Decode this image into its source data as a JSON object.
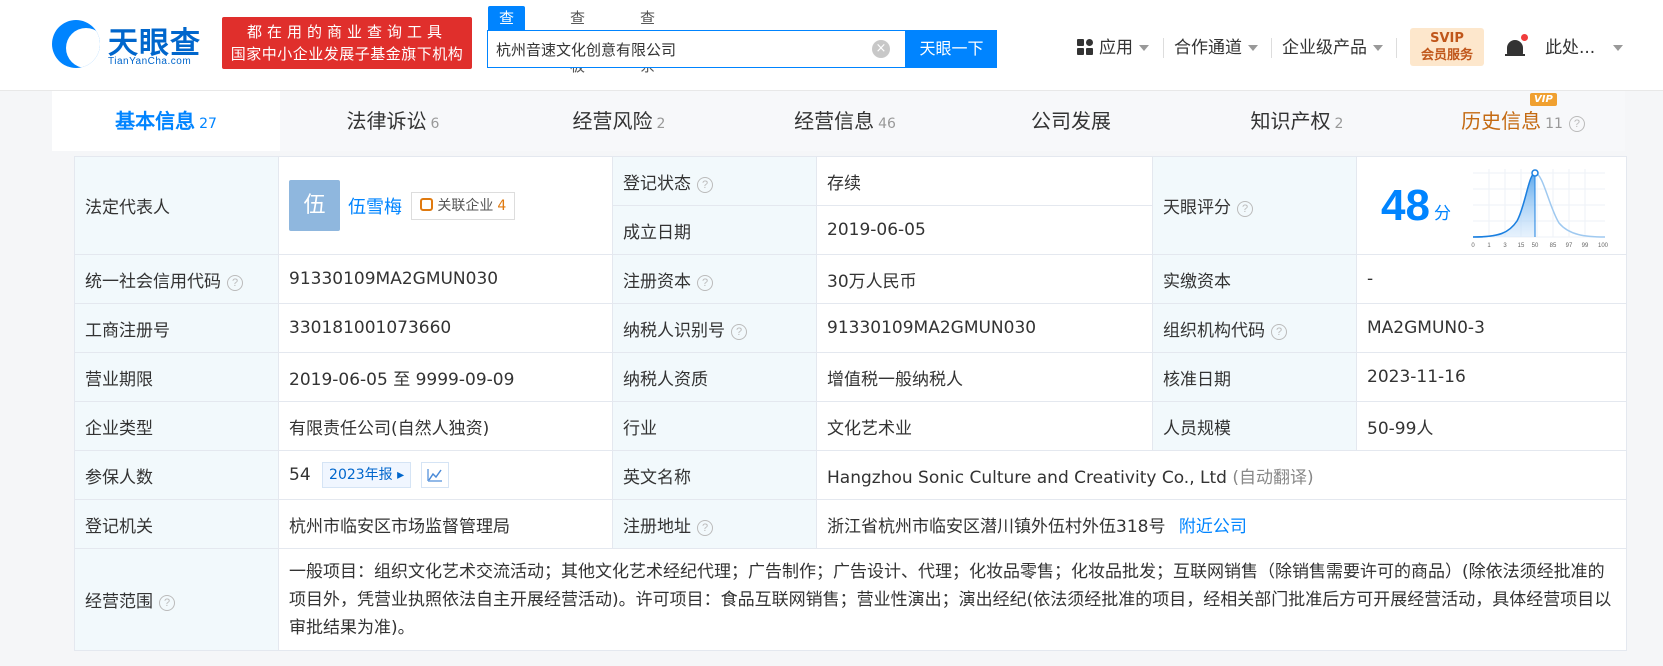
{
  "header": {
    "logo_name": "天眼查",
    "logo_domain": "TianYanCha.com",
    "slogan_line1": "都在用的商业查询工具",
    "slogan_line2": "国家中小企业发展子基金旗下机构",
    "search_tabs": [
      "查公司",
      "查老板",
      "查关系"
    ],
    "search_value": "杭州音速文化创意有限公司",
    "search_button": "天眼一下",
    "nav": {
      "apps": "应用",
      "partners": "合作通道",
      "enterprise": "企业级产品",
      "svip_line1": "SVIP",
      "svip_line2": "会员服务",
      "user": "此处..."
    }
  },
  "tabs": [
    {
      "label": "基本信息",
      "count": "27"
    },
    {
      "label": "法律诉讼",
      "count": "6"
    },
    {
      "label": "经营风险",
      "count": "2"
    },
    {
      "label": "经营信息",
      "count": "46"
    },
    {
      "label": "公司发展",
      "count": ""
    },
    {
      "label": "知识产权",
      "count": "2"
    },
    {
      "label": "历史信息",
      "count": "11"
    }
  ],
  "vip_tag": "VIP",
  "info": {
    "legal_rep_label": "法定代表人",
    "legal_rep_avatar": "伍",
    "legal_rep_name": "伍雪梅",
    "related_label": "关联企业",
    "related_count": "4",
    "reg_status_label": "登记状态",
    "reg_status": "存续",
    "founded_label": "成立日期",
    "founded": "2019-06-05",
    "score_label": "天眼评分",
    "score": "48",
    "score_unit": "分",
    "score_axis": [
      "0",
      "1",
      "3",
      "15",
      "50",
      "85",
      "97",
      "99",
      "100"
    ],
    "credit_code_label": "统一社会信用代码",
    "credit_code": "91330109MA2GMUN030",
    "reg_capital_label": "注册资本",
    "reg_capital": "30万人民币",
    "paid_capital_label": "实缴资本",
    "paid_capital": "-",
    "biz_reg_no_label": "工商注册号",
    "biz_reg_no": "330181001073660",
    "taxpayer_id_label": "纳税人识别号",
    "taxpayer_id": "91330109MA2GMUN030",
    "org_code_label": "组织机构代码",
    "org_code": "MA2GMUN0-3",
    "term_label": "营业期限",
    "term": "2019-06-05 至 9999-09-09",
    "tax_qual_label": "纳税人资质",
    "tax_qual": "增值税一般纳税人",
    "approve_date_label": "核准日期",
    "approve_date": "2023-11-16",
    "type_label": "企业类型",
    "type": "有限责任公司(自然人独资)",
    "industry_label": "行业",
    "industry": "文化艺术业",
    "staff_label": "人员规模",
    "staff": "50-99人",
    "insured_label": "参保人数",
    "insured": "54",
    "insured_report": "2023年报",
    "en_name_label": "英文名称",
    "en_name": "Hangzhou Sonic Culture and Creativity Co., Ltd",
    "en_name_note": "(自动翻译)",
    "authority_label": "登记机关",
    "authority": "杭州市临安区市场监督管理局",
    "address_label": "注册地址",
    "address": "浙江省杭州市临安区潜川镇外伍村外伍318号",
    "nearby": "附近公司",
    "scope_label": "经营范围",
    "scope": "一般项目：组织文化艺术交流活动；其他文化艺术经纪代理；广告制作；广告设计、代理；化妆品零售；化妆品批发；互联网销售（除销售需要许可的商品）(除依法须经批准的项目外，凭营业执照依法自主开展经营活动)。许可项目：食品互联网销售；营业性演出；演出经纪(依法须经批准的项目，经相关部门批准后方可开展经营活动，具体经营项目以审批结果为准)。"
  },
  "colors": {
    "accent": "#0084ff",
    "history": "#c46a12",
    "status_green": "#2e9a3f",
    "slogan_red": "#e02f2c"
  }
}
